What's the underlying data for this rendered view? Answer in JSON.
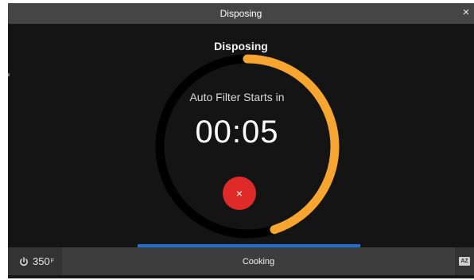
{
  "window": {
    "title": "Disposing",
    "close_glyph": "×"
  },
  "main": {
    "heading": "Disposing",
    "subtitle": "Auto Filter Starts in",
    "countdown": "00:05",
    "cancel_glyph": "×",
    "ring_progress_fraction": 0.45,
    "ring_color": "#F7A531",
    "ring_track_color": "#000000"
  },
  "bottom_bar": {
    "power_value": "350",
    "power_unit": "F",
    "power_icon": "power-icon",
    "mode_label": "Cooking",
    "az_icon": "az-icon",
    "az_text": "AZ"
  },
  "colors": {
    "accent_orange": "#F7A531",
    "cancel_red": "#DF2A2A",
    "progress_blue": "#1F6FD1",
    "bar_gray": "#454545"
  }
}
